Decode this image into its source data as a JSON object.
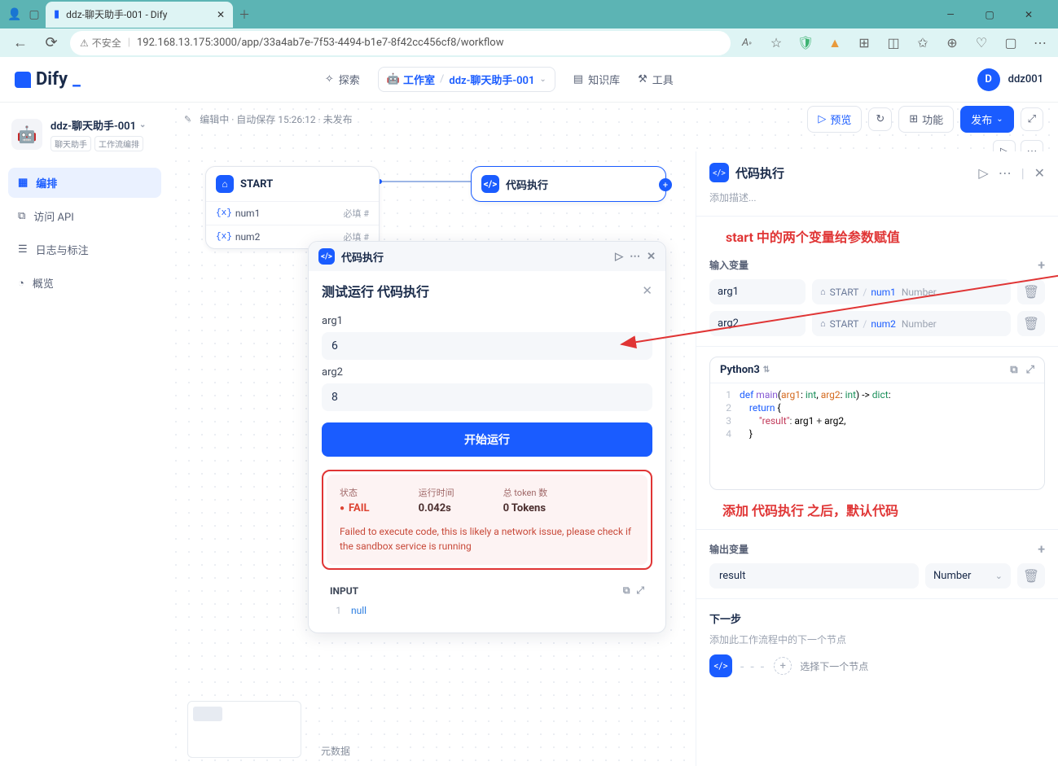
{
  "browser": {
    "tab_title": "ddz-聊天助手-001 - Dify",
    "security": "不安全",
    "url": "192.168.13.175:3000/app/33a4ab7e-7f53-4494-b1e7-8f42cc456cf8/workflow"
  },
  "header": {
    "logo": "Dify",
    "nav_explore": "探索",
    "nav_workspace": "工作室",
    "nav_app": "ddz-聊天助手-001",
    "nav_knowledge": "知识库",
    "nav_tools": "工具",
    "user_initial": "D",
    "user_name": "ddz001"
  },
  "sidebar": {
    "app_name": "ddz-聊天助手-001",
    "tags": [
      "聊天助手",
      "工作流编排"
    ],
    "items": [
      {
        "label": "编排"
      },
      {
        "label": "访问 API"
      },
      {
        "label": "日志与标注"
      },
      {
        "label": "概览"
      }
    ]
  },
  "statusbar": {
    "text": "编辑中 · 自动保存 15:26:12 · 未发布",
    "preview": "预览",
    "features": "功能",
    "publish": "发布"
  },
  "nodes": {
    "start_title": "START",
    "start_vars": [
      {
        "name": "num1",
        "req": "必填 #"
      },
      {
        "name": "num2",
        "req": "必填 #"
      }
    ],
    "code_title": "代码执行"
  },
  "testpanel": {
    "hdr": "代码执行",
    "title": "测试运行 代码执行",
    "arg1_lbl": "arg1",
    "arg1_val": "6",
    "arg2_lbl": "arg2",
    "arg2_val": "8",
    "run": "开始运行",
    "status_lbl": "状态",
    "status_val": "FAIL",
    "time_lbl": "运行时间",
    "time_val": "0.042s",
    "tokens_lbl": "总 token 数",
    "tokens_val": "0 Tokens",
    "error": "Failed to execute code, this is likely a network issue, please check if the sandbox service is running",
    "input_lbl": "INPUT",
    "input_val": "null",
    "meta": "元数据"
  },
  "rightpanel": {
    "title": "代码执行",
    "desc_ph": "添加描述...",
    "annot1": "start 中的两个变量给参数赋值",
    "inputs_lbl": "输入变量",
    "inputs": [
      {
        "name": "arg1",
        "src_app": "START",
        "src_var": "num1",
        "src_type": "Number"
      },
      {
        "name": "arg2",
        "src_app": "START",
        "src_var": "num2",
        "src_type": "Number"
      }
    ],
    "lang": "Python3",
    "annot2": "添加 代码执行 之后，默认代码",
    "outputs_lbl": "输出变量",
    "outputs": [
      {
        "name": "result",
        "type": "Number"
      }
    ],
    "next_lbl": "下一步",
    "next_desc": "添加此工作流程中的下一个节点",
    "next_choose": "选择下一个节点"
  }
}
